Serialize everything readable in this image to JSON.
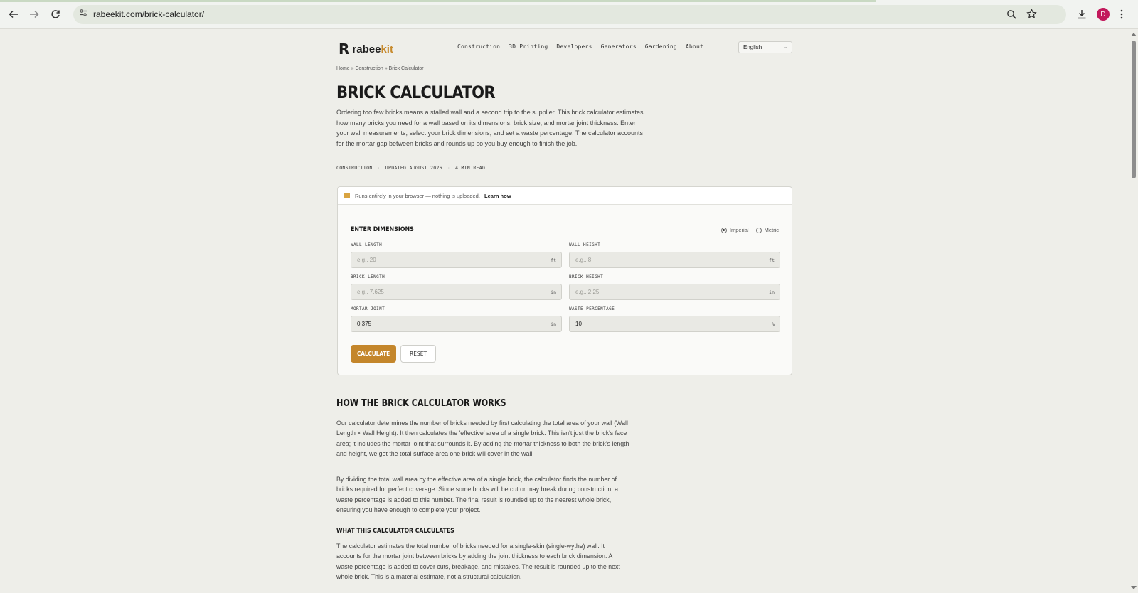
{
  "browser": {
    "url": "rabeekit.com/brick-calculator/",
    "avatar_initial": "D"
  },
  "site": {
    "logo_mark": "R",
    "logo_text_a": "rabee",
    "logo_text_b": "kit",
    "nav": [
      "Construction",
      "3D Printing",
      "Developers",
      "Generators",
      "Gardening",
      "About"
    ],
    "language": "English"
  },
  "page": {
    "breadcrumb": "Home » Construction » Brick Calculator",
    "title": "BRICK CALCULATOR",
    "intro": "Ordering too few bricks means a stalled wall and a second trip to the supplier. This brick calculator estimates how many bricks you need for a wall based on its dimensions, brick size, and mortar joint thickness. Enter your wall measurements, select your brick dimensions, and set a waste percentage. The calculator accounts for the mortar gap between bricks and rounds up so you buy enough to finish the job.",
    "meta": [
      "CONSTRUCTION",
      "UPDATED AUGUST 2026",
      "4 MIN READ"
    ]
  },
  "calculator": {
    "notice": "Runs entirely in your browser — nothing is uploaded.",
    "notice_link": "Learn how",
    "heading": "ENTER DIMENSIONS",
    "unit_imperial": "Imperial",
    "unit_metric": "Metric",
    "fields": {
      "wall_length": {
        "label": "WALL LENGTH",
        "placeholder": "e.g., 20",
        "value": "",
        "unit": "ft"
      },
      "wall_height": {
        "label": "WALL HEIGHT",
        "placeholder": "e.g., 8",
        "value": "",
        "unit": "ft"
      },
      "brick_length": {
        "label": "BRICK LENGTH",
        "placeholder": "e.g., 7.625",
        "value": "",
        "unit": "in"
      },
      "brick_height": {
        "label": "BRICK HEIGHT",
        "placeholder": "e.g., 2.25",
        "value": "",
        "unit": "in"
      },
      "mortar_joint": {
        "label": "MORTAR JOINT",
        "placeholder": "",
        "value": "0.375",
        "unit": "in"
      },
      "waste_percentage": {
        "label": "WASTE PERCENTAGE",
        "placeholder": "",
        "value": "10",
        "unit": "%"
      }
    },
    "calculate_label": "CALCULATE",
    "reset_label": "RESET"
  },
  "content": {
    "how_heading": "HOW THE BRICK CALCULATOR WORKS",
    "how_p1": "Our calculator determines the number of bricks needed by first calculating the total area of your wall (Wall Length × Wall Height). It then calculates the 'effective' area of a single brick. This isn't just the brick's face area; it includes the mortar joint that surrounds it. By adding the mortar thickness to both the brick's length and height, we get the total surface area one brick will cover in the wall.",
    "how_p2": "By dividing the total wall area by the effective area of a single brick, the calculator finds the number of bricks required for perfect coverage. Since some bricks will be cut or may break during construction, a waste percentage is added to this number. The final result is rounded up to the nearest whole brick, ensuring you have enough to complete your project.",
    "what_heading": "WHAT THIS CALCULATOR CALCULATES",
    "what_p1": "The calculator estimates the total number of bricks needed for a single-skin (single-wythe) wall. It accounts for the mortar joint between bricks by adding the joint thickness to each brick dimension. A waste percentage is added to cover cuts, breakage, and mistakes. The result is rounded up to the next whole brick. This is a material estimate, not a structural calculation."
  }
}
